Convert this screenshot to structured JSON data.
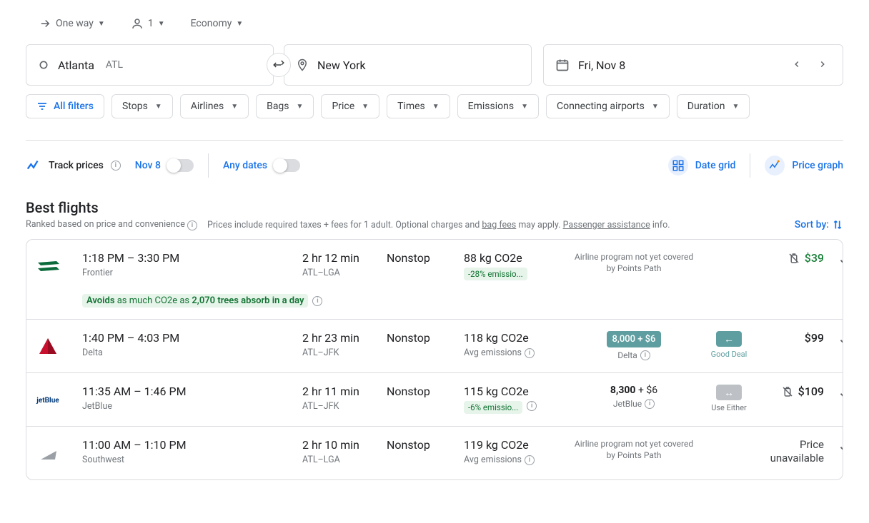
{
  "top": {
    "trip_type": "One way",
    "passengers": "1",
    "cabin": "Economy"
  },
  "search": {
    "origin_city": "Atlanta",
    "origin_code": "ATL",
    "dest_city": "New York",
    "date": "Fri, Nov 8"
  },
  "filters": {
    "all": "All filters",
    "chips": [
      "Stops",
      "Airlines",
      "Bags",
      "Price",
      "Times",
      "Emissions",
      "Connecting airports",
      "Duration"
    ]
  },
  "track": {
    "label": "Track prices",
    "specific": "Nov 8",
    "any": "Any dates",
    "date_grid": "Date grid",
    "price_graph": "Price graph"
  },
  "section": {
    "title": "Best flights",
    "ranked": "Ranked based on price and convenience",
    "prices_note_prefix": "Prices include required taxes + fees for 1 adult. Optional charges and ",
    "bag_fees": "bag fees",
    "prices_note_mid": " may apply. ",
    "assistance": "Passenger assistance",
    "prices_note_suffix": " info.",
    "sort": "Sort by:"
  },
  "flights": [
    {
      "logo_text": "",
      "logo_color": "#0b6b3a",
      "times": "1:18 PM – 3:30 PM",
      "airline": "Frontier",
      "duration": "2 hr 12 min",
      "route": "ATL–LGA",
      "stops": "Nonstop",
      "co2": "88 kg CO2e",
      "co2_badge": "-28% emissio...",
      "program": "Airline program not yet covered by Points Path",
      "price": "$39",
      "price_green": true,
      "has_bag": true,
      "eco_prefix": "Avoids",
      "eco_mid": " as much CO2e as ",
      "eco_bold": "2,070 trees absorb in a day"
    },
    {
      "logo_text": "",
      "logo_color": "#c8102e",
      "times": "1:40 PM – 4:03 PM",
      "airline": "Delta",
      "duration": "2 hr 23 min",
      "route": "ATL–JFK",
      "stops": "Nonstop",
      "co2": "118 kg CO2e",
      "co2_avg": "Avg emissions",
      "points": "8,000 + $6",
      "points_program": "Delta",
      "deal_label": "Good Deal",
      "deal_type": "arrow",
      "price": "$99",
      "price_green": false
    },
    {
      "logo_text": "jetBlue",
      "logo_color": "#003876",
      "times": "11:35 AM – 1:46 PM",
      "airline": "JetBlue",
      "duration": "2 hr 11 min",
      "route": "ATL–JFK",
      "stops": "Nonstop",
      "co2": "115 kg CO2e",
      "co2_badge": "-6% emissio...",
      "points_plain": "8,300",
      "points_plain_suffix": " + $6",
      "points_program": "JetBlue",
      "deal_label": "Use Either",
      "deal_type": "grey",
      "price": "$109",
      "price_green": false,
      "has_bag": true
    },
    {
      "logo_text": "",
      "logo_color": "#9aa0a6",
      "times": "11:00 AM – 1:10 PM",
      "airline": "Southwest",
      "duration": "2 hr 10 min",
      "route": "ATL–LGA",
      "stops": "Nonstop",
      "co2": "119 kg CO2e",
      "co2_avg": "Avg emissions",
      "program": "Airline program not yet covered by Points Path",
      "price_unavailable": "Price unavailable"
    }
  ]
}
